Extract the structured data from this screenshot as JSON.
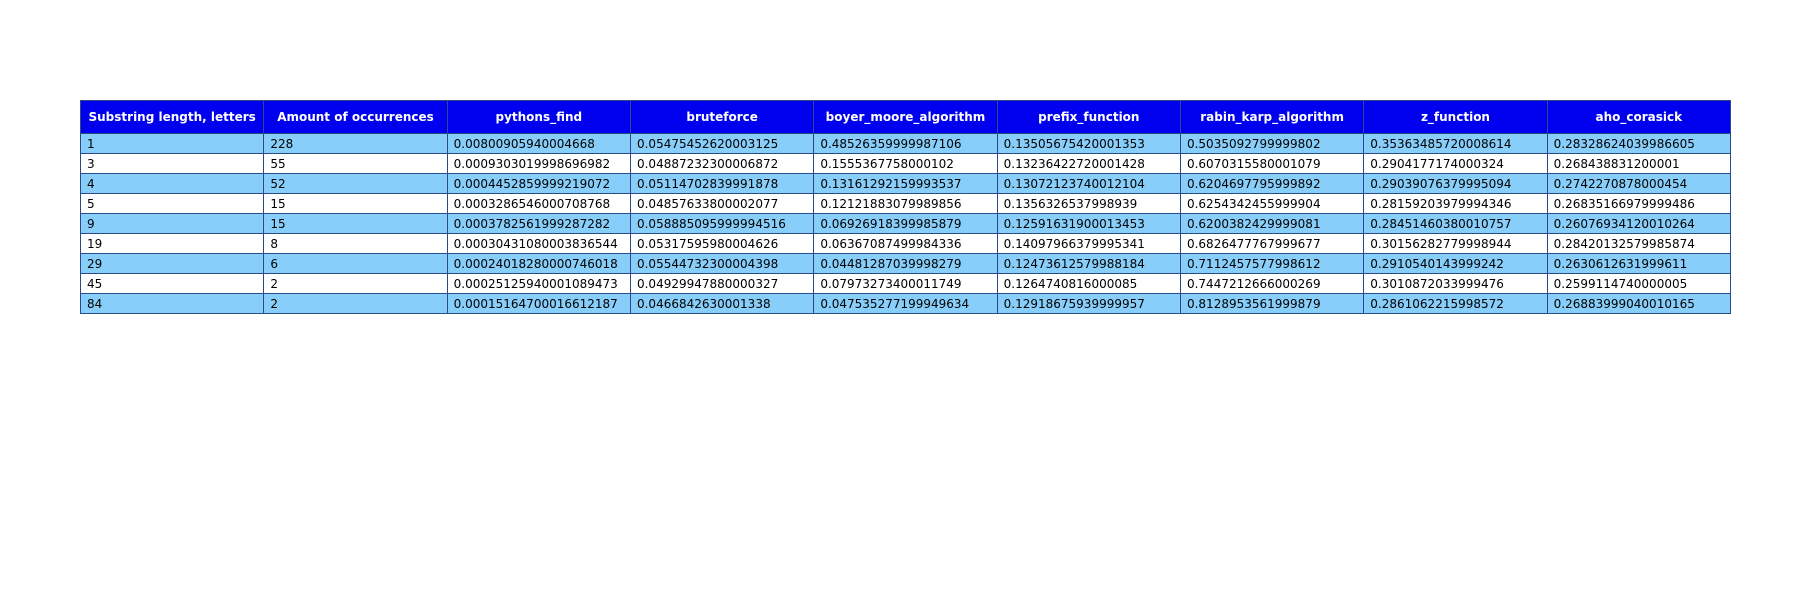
{
  "chart_data": {
    "type": "table",
    "colors": {
      "header_bg": "#0000ee",
      "header_text": "#ffffff",
      "row_odd_bg": "#87cefa",
      "row_even_bg": "#ffffff",
      "border": "#2a4a8a"
    },
    "columns": [
      "Substring length, letters",
      "Amount of occurrences",
      "pythons_find",
      "bruteforce",
      "boyer_moore_algorithm",
      "prefix_function",
      "rabin_karp_algorithm",
      "z_function",
      "aho_corasick"
    ],
    "rows": [
      [
        "1",
        "228",
        "0.00800905940004668",
        "0.05475452620003125",
        "0.48526359999987106",
        "0.13505675420001353",
        "0.5035092799999802",
        "0.35363485720008614",
        "0.28328624039986605"
      ],
      [
        "3",
        "55",
        "0.0009303019998696982",
        "0.04887232300006872",
        "0.1555367758000102",
        "0.13236422720001428",
        "0.6070315580001079",
        "0.2904177174000324",
        "0.268438831200001"
      ],
      [
        "4",
        "52",
        "0.0004452859999219072",
        "0.05114702839991878",
        "0.13161292159993537",
        "0.13072123740012104",
        "0.6204697795999892",
        "0.29039076379995094",
        "0.2742270878000454"
      ],
      [
        "5",
        "15",
        "0.0003286546000708768",
        "0.04857633800002077",
        "0.12121883079989856",
        "0.1356326537998939",
        "0.6254342455999904",
        "0.28159203979994346",
        "0.26835166979999486"
      ],
      [
        "9",
        "15",
        "0.0003782561999287282",
        "0.058885095999994516",
        "0.06926918399985879",
        "0.12591631900013453",
        "0.6200382429999081",
        "0.28451460380010757",
        "0.26076934120010264"
      ],
      [
        "19",
        "8",
        "0.00030431080003836544",
        "0.05317595980004626",
        "0.06367087499984336",
        "0.14097966379995341",
        "0.6826477767999677",
        "0.30156282779998944",
        "0.28420132579985874"
      ],
      [
        "29",
        "6",
        "0.00024018280000746018",
        "0.05544732300004398",
        "0.04481287039998279",
        "0.12473612579988184",
        "0.7112457577998612",
        "0.2910540143999242",
        "0.2630612631999611"
      ],
      [
        "45",
        "2",
        "0.00025125940001089473",
        "0.04929947880000327",
        "0.07973273400011749",
        "0.1264740816000085",
        "0.7447212666000269",
        "0.3010872033999476",
        "0.2599114740000005"
      ],
      [
        "84",
        "2",
        "0.00015164700016612187",
        "0.0466842630001338",
        "0.047535277199949634",
        "0.12918675939999957",
        "0.8128953561999879",
        "0.2861062215998572",
        "0.26883999040010165"
      ]
    ]
  }
}
